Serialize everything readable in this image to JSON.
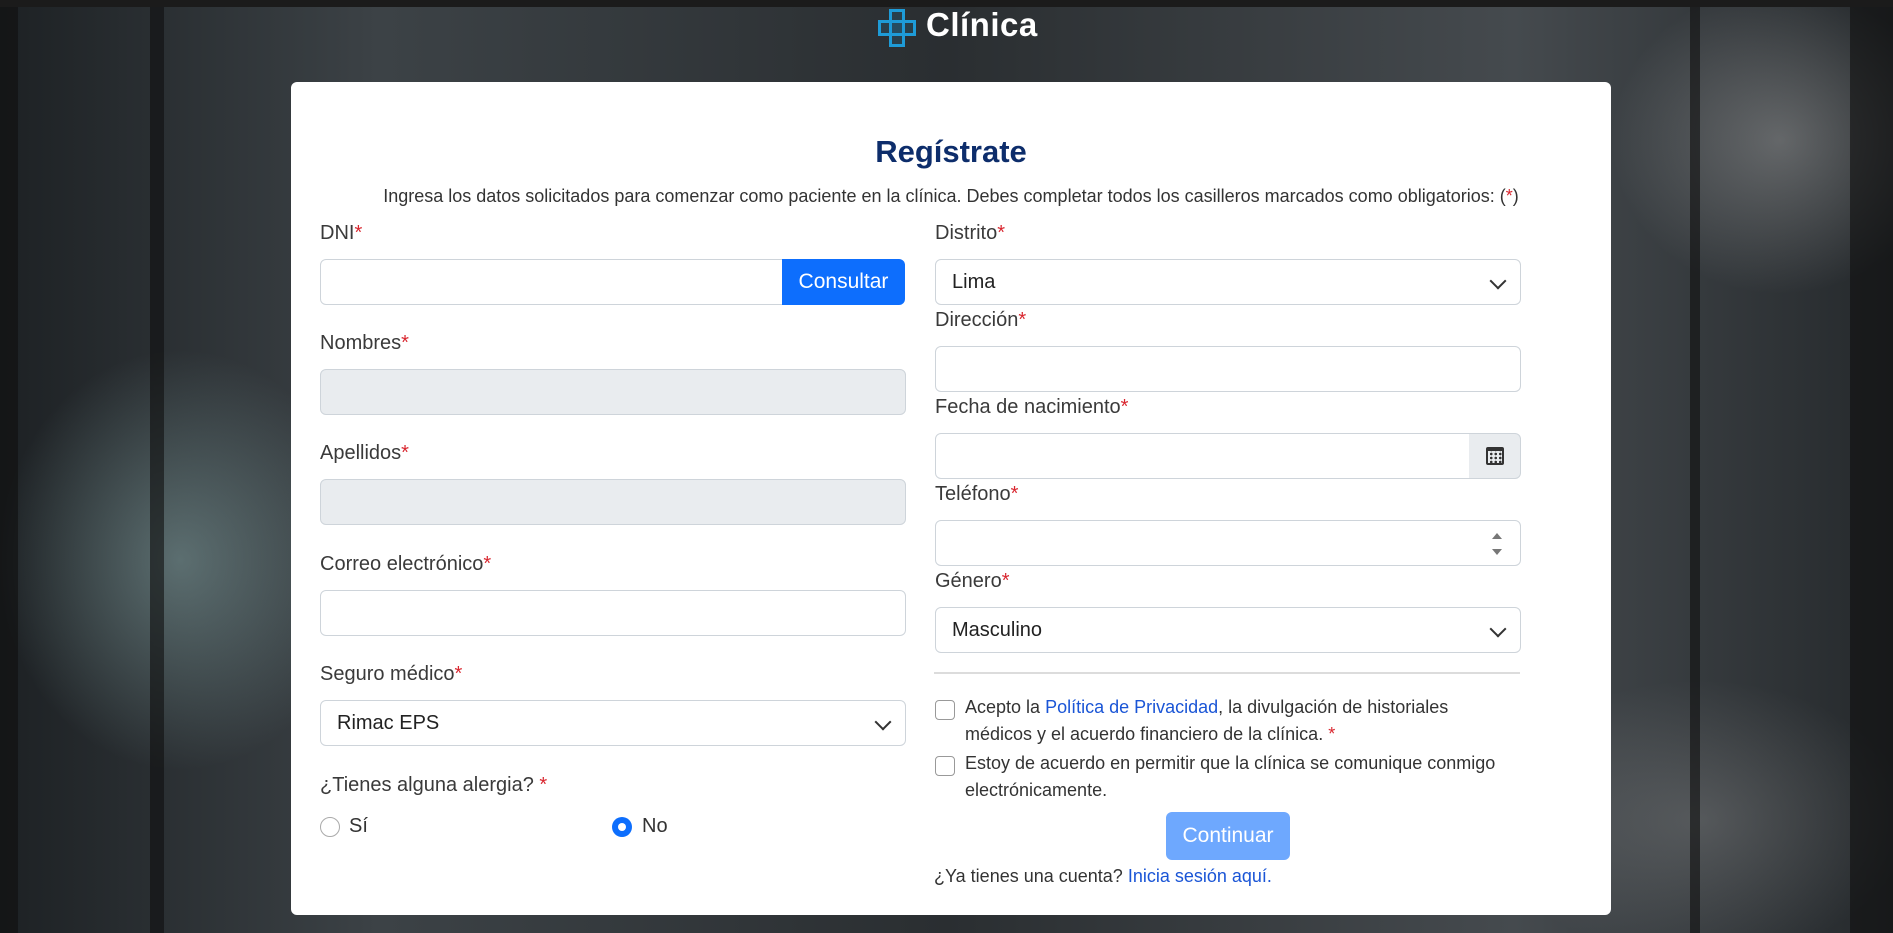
{
  "brand": {
    "name": "Clínica"
  },
  "form": {
    "title": "Regístrate",
    "subtitle": "Ingresa los datos solicitados para comenzar como paciente en la clínica. Debes completar todos los casilleros marcados como obligatorios:",
    "subtitle_req_open": "(",
    "subtitle_req_star": "*",
    "subtitle_req_close": ")",
    "required_mark": "*",
    "dni": {
      "label": "DNI",
      "value": "",
      "button": "Consultar"
    },
    "nombres": {
      "label": "Nombres",
      "value": ""
    },
    "apellidos": {
      "label": "Apellidos",
      "value": ""
    },
    "correo": {
      "label": "Correo electrónico",
      "value": ""
    },
    "seguro": {
      "label": "Seguro médico",
      "selected": "Rimac EPS"
    },
    "alergia": {
      "label": "¿Tienes alguna alergia?",
      "options": [
        "Sí",
        "No"
      ],
      "selected": "No"
    },
    "distrito": {
      "label": "Distrito",
      "selected": "Lima"
    },
    "direccion": {
      "label": "Dirección",
      "value": ""
    },
    "fecha": {
      "label": "Fecha de nacimiento",
      "value": "",
      "icon": "calendar-icon"
    },
    "telefono": {
      "label": "Teléfono",
      "value": ""
    },
    "genero": {
      "label": "Género",
      "selected": "Masculino"
    },
    "consent1": {
      "text_before": "Acepto la ",
      "link": "Política de Privacidad",
      "text_after": ", la divulgación de historiales médicos y el acuerdo financiero de la clínica.",
      "checked": false
    },
    "consent2": {
      "text": "Estoy de acuerdo en permitir que la clínica se comunique conmigo electrónicamente.",
      "checked": false
    },
    "submit": "Continuar",
    "login_prompt": "¿Ya tienes una cuenta?",
    "login_link": "Inicia sesión aquí."
  },
  "colors": {
    "primary": "#0d6efd",
    "primary_disabled": "#6ea8fe",
    "title": "#0d2d6b",
    "required": "#d9262f",
    "link": "#1a55d6"
  }
}
